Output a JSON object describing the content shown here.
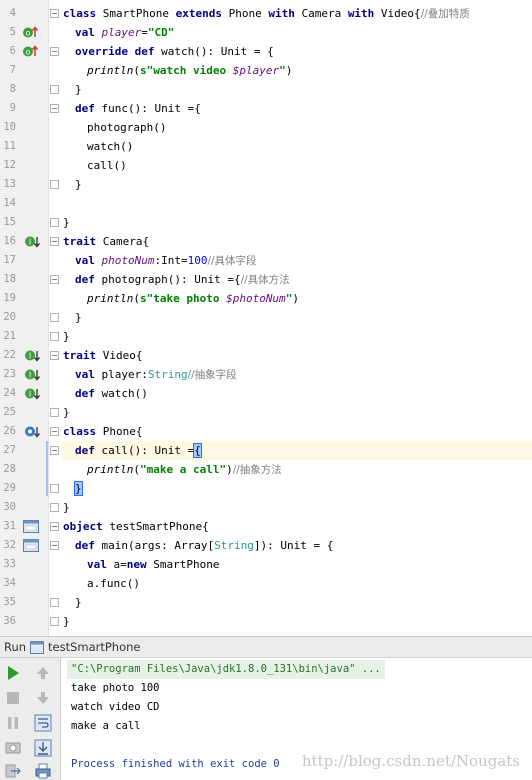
{
  "editor": {
    "lines": {
      "l4": {
        "num": "4",
        "t": [
          "class",
          " SmartPhone ",
          "extends",
          " Phone ",
          "with",
          " Camera ",
          "with",
          " Video{",
          "//叠加特质"
        ]
      },
      "l5": {
        "num": "5",
        "t": [
          "val",
          " ",
          "player",
          "=",
          "\"CD\""
        ]
      },
      "l6": {
        "num": "6",
        "t": [
          "override",
          " ",
          "def",
          " watch(): Unit = {"
        ]
      },
      "l7": {
        "num": "7",
        "t": [
          "println",
          "(",
          "s\"watch video ",
          "$player",
          "\"",
          ")"
        ]
      },
      "l8": {
        "num": "8",
        "t": [
          "}"
        ]
      },
      "l9": {
        "num": "9",
        "t": [
          "def",
          " func(): Unit ={"
        ]
      },
      "l10": {
        "num": "10",
        "t": [
          "photograph()"
        ]
      },
      "l11": {
        "num": "11",
        "t": [
          "watch()"
        ]
      },
      "l12": {
        "num": "12",
        "t": [
          "call()"
        ]
      },
      "l13": {
        "num": "13",
        "t": [
          "}"
        ]
      },
      "l14": {
        "num": "14",
        "t": [
          ""
        ]
      },
      "l15": {
        "num": "15",
        "t": [
          "}"
        ]
      },
      "l16": {
        "num": "16",
        "t": [
          "trait",
          " Camera{"
        ]
      },
      "l17": {
        "num": "17",
        "t": [
          "val",
          " ",
          "photoNum",
          ":Int=",
          "100",
          "//具体字段"
        ]
      },
      "l18": {
        "num": "18",
        "t": [
          "def",
          " photograph(): Unit ={",
          "//具体方法"
        ]
      },
      "l19": {
        "num": "19",
        "t": [
          "println",
          "(",
          "s\"take photo ",
          "$photoNum",
          "\"",
          ")"
        ]
      },
      "l20": {
        "num": "20",
        "t": [
          "}"
        ]
      },
      "l21": {
        "num": "21",
        "t": [
          "}"
        ]
      },
      "l22": {
        "num": "22",
        "t": [
          "trait",
          " Video{"
        ]
      },
      "l23": {
        "num": "23",
        "t": [
          "val",
          " player:",
          "String",
          "//抽象字段"
        ]
      },
      "l24": {
        "num": "24",
        "t": [
          "def",
          " watch()"
        ]
      },
      "l25": {
        "num": "25",
        "t": [
          "}"
        ]
      },
      "l26": {
        "num": "26",
        "t": [
          "class",
          " Phone{"
        ]
      },
      "l27": {
        "num": "27",
        "t": [
          "def",
          " call(): Unit =",
          "{"
        ]
      },
      "l28": {
        "num": "28",
        "t": [
          "println",
          "(",
          "\"make a call\"",
          ")",
          "//抽象方法"
        ]
      },
      "l29": {
        "num": "29",
        "t": [
          "}"
        ]
      },
      "l30": {
        "num": "30",
        "t": [
          "}"
        ]
      },
      "l31": {
        "num": "31",
        "t": [
          "object",
          " testSmartPhone{"
        ]
      },
      "l32": {
        "num": "32",
        "t": [
          "def",
          " main(args: Array[",
          "String",
          "]): Unit = {"
        ]
      },
      "l33": {
        "num": "33",
        "t": [
          "val",
          " a=",
          "new",
          " SmartPhone"
        ]
      },
      "l34": {
        "num": "34",
        "t": [
          "a.func()"
        ]
      },
      "l35": {
        "num": "35",
        "t": [
          "}"
        ]
      },
      "l36": {
        "num": "36",
        "t": [
          "}"
        ]
      }
    }
  },
  "run_panel": {
    "title": "Run",
    "tab_label": "testSmartPhone",
    "console": {
      "command": "\"C:\\Program Files\\Java\\jdk1.8.0_131\\bin\\java\" ...",
      "output": [
        "take photo 100",
        "watch video CD",
        "make a call"
      ],
      "finish": "Process finished with exit code 0"
    },
    "watermark": "http://blog.csdn.net/Nougats"
  },
  "colors": {
    "keyword": "#000080",
    "string": "#008000",
    "field": "#660e7a",
    "number": "#0000ff",
    "comment": "#808080",
    "caret_line": "#fffae3",
    "run_green": "#2e9a2e"
  },
  "icons": {
    "override": "override-marker-icon",
    "implements": "implemented-marker-icon",
    "run_gutter": "run-gutter-icon",
    "fold": "fold-marker-icon"
  }
}
